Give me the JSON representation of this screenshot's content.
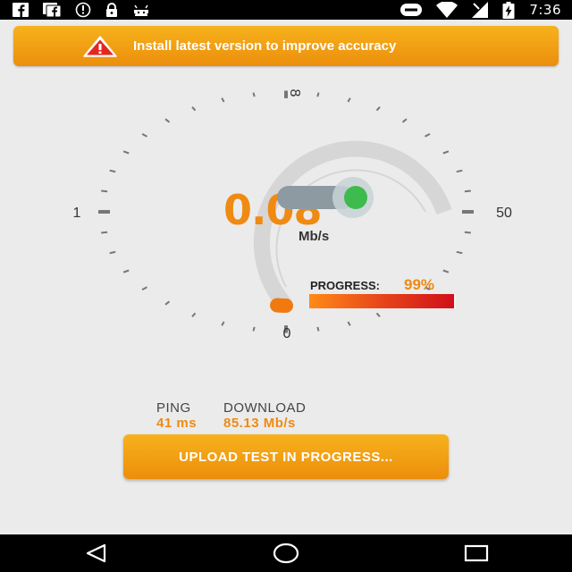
{
  "status_bar": {
    "time": "7:36",
    "left_icons": [
      "facebook-icon",
      "facebook-messenger-icon",
      "info-icon",
      "lock-icon",
      "android-icon"
    ],
    "right_icons": [
      "toggle-icon",
      "wifi-icon",
      "signal-icon",
      "battery-charging-icon"
    ]
  },
  "banner": {
    "message": "Install latest version to improve accuracy",
    "icon": "warning-icon"
  },
  "gauge": {
    "label_min": "0",
    "label_left": "1",
    "label_top": "8",
    "label_right": "50",
    "speed": "0.08",
    "unit": "Mb/s",
    "fill": 0.02
  },
  "progress": {
    "label": "PROGRESS:",
    "value_text": "99%",
    "value": 0.99
  },
  "stats": {
    "ping_label": "PING",
    "ping_value": "41 ms",
    "download_label": "DOWNLOAD",
    "download_value": "85.13 Mb/s"
  },
  "action_button": {
    "label": "UPLOAD TEST IN PROGRESS..."
  },
  "nav_bar": {
    "buttons": [
      "back-icon",
      "home-icon",
      "recents-icon"
    ]
  },
  "colors": {
    "accent": "#ef8a12",
    "banner": "#f2a016",
    "toggle_knob": "#3dbb4c"
  }
}
